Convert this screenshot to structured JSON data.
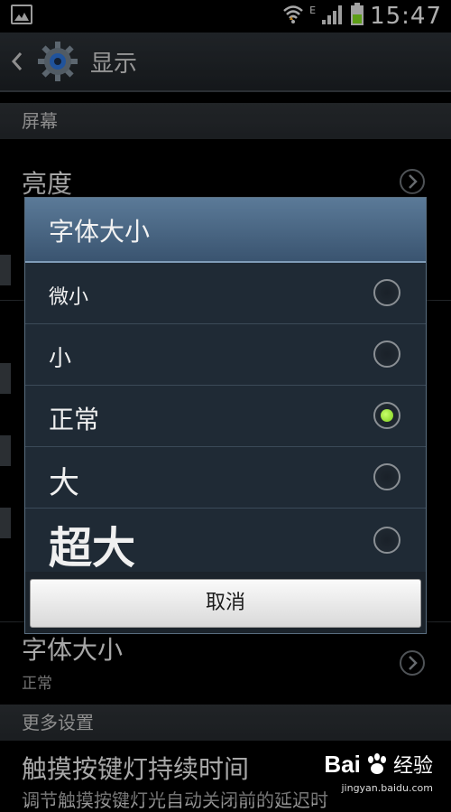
{
  "status_bar": {
    "network_type": "E",
    "time": "15:47"
  },
  "action_bar": {
    "title": "显示"
  },
  "settings": {
    "screen_section": "屏幕",
    "brightness_label": "亮度",
    "font_size_label": "字体大小",
    "font_size_value": "正常",
    "more_section": "更多设置",
    "touch_key_label": "触摸按键灯持续时间",
    "touch_key_desc": "调节触摸按键灯光自动关闭前的延迟时"
  },
  "dialog": {
    "title": "字体大小",
    "options": [
      {
        "label": "微小",
        "selected": false
      },
      {
        "label": "小",
        "selected": false
      },
      {
        "label": "正常",
        "selected": true
      },
      {
        "label": "大",
        "selected": false
      },
      {
        "label": "超大",
        "selected": false
      }
    ],
    "cancel_label": "取消"
  },
  "watermark": {
    "brand": "Bai",
    "brand_suffix": "经验",
    "url": "jingyan.baidu.com"
  },
  "colors": {
    "dialog_title_bg": "#4a6684",
    "selected_radio": "#8edb2a"
  }
}
